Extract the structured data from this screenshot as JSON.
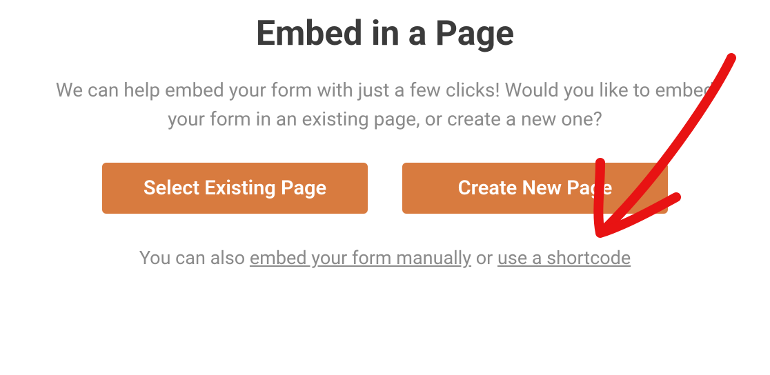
{
  "title": "Embed in a Page",
  "description": "We can help embed your form with just a few clicks! Would you like to embed your form in an existing page, or create a new one?",
  "buttons": {
    "selectExisting": "Select Existing Page",
    "createNew": "Create New Page"
  },
  "footer": {
    "prefix": "You can also ",
    "link1": "embed your form manually",
    "middle": " or ",
    "link2": "use a shortcode"
  },
  "annotation": {
    "color": "#e81313"
  }
}
